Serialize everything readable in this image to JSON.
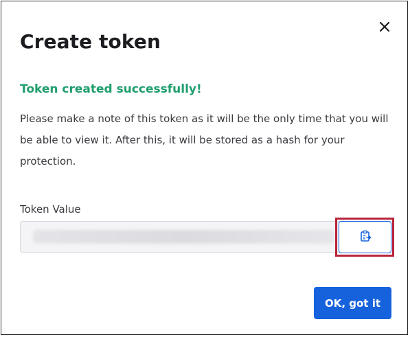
{
  "dialog": {
    "title": "Create token",
    "close_icon": "close-icon",
    "success_message": "Token created successfully!",
    "description": "Please make a note of this token as it will be the only time that you will be able to view it. After this, it will be stored as a hash for your protection.",
    "token_label": "Token Value",
    "token_value": "",
    "copy_icon": "clipboard-copy-icon",
    "ok_label": "OK, got it"
  },
  "colors": {
    "success": "#1f9e6e",
    "primary": "#1662dd",
    "highlight": "#b8243a"
  }
}
